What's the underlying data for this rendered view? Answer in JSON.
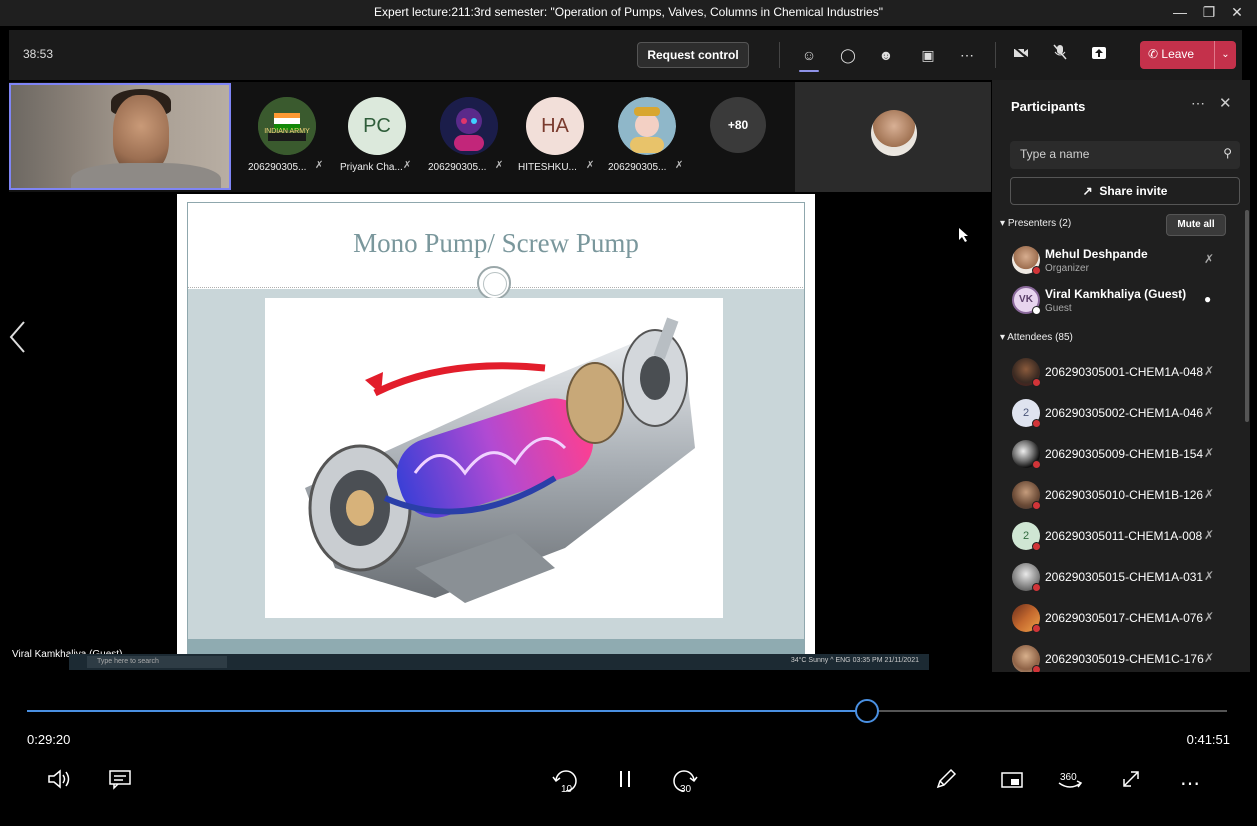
{
  "window": {
    "title": "Expert lecture:211:3rd semester: \"Operation of Pumps, Valves, Columns in Chemical Industries\""
  },
  "meeting": {
    "elapsed": "38:53",
    "request_control": "Request control",
    "leave": "Leave",
    "more_count": "+80"
  },
  "strip": {
    "participants": [
      {
        "name": "206290305...",
        "avatar_text": "INDIAN ARMY",
        "avatar_color": "#2e4d2a"
      },
      {
        "name": "Priyank Cha...",
        "avatar_text": "PC",
        "avatar_color": "#dce9dc"
      },
      {
        "name": "206290305...",
        "avatar_text": "",
        "avatar_color": "#2a2f6a"
      },
      {
        "name": "HITESHKU...",
        "avatar_text": "HA",
        "avatar_color": "#f2dfd9"
      },
      {
        "name": "206290305...",
        "avatar_text": "",
        "avatar_color": "#8fb7c9"
      }
    ]
  },
  "content": {
    "slide_title": "Mono Pump/ Screw Pump",
    "presenter_label": "Viral Kamkhaliya (Guest)",
    "taskbar_search": "Type here to search",
    "taskbar_tray": "34°C Sunny  ^ ENG 03:35 PM 21/11/2021"
  },
  "panel": {
    "title": "Participants",
    "search_placeholder": "Type a name",
    "share_invite": "Share invite",
    "presenters_header": "Presenters (2)",
    "mute_all": "Mute all",
    "presenters": [
      {
        "name": "Mehul Deshpande",
        "role": "Organizer"
      },
      {
        "name": "Viral Kamkhaliya (Guest)",
        "role": "Guest",
        "initials": "VK"
      }
    ],
    "attendees_header": "Attendees (85)",
    "attendees": [
      {
        "name": "206290305001-CHEM1A-048"
      },
      {
        "name": "206290305002-CHEM1A-046",
        "initials": "2"
      },
      {
        "name": "206290305009-CHEM1B-154"
      },
      {
        "name": "206290305010-CHEM1B-126"
      },
      {
        "name": "206290305011-CHEM1A-008",
        "initials": "2"
      },
      {
        "name": "206290305015-CHEM1A-031"
      },
      {
        "name": "206290305017-CHEM1A-076"
      },
      {
        "name": "206290305019-CHEM1C-176"
      }
    ]
  },
  "player": {
    "current": "0:29:20",
    "duration": "0:41:51",
    "progress": 0.7,
    "accent": "#4a90e2"
  }
}
